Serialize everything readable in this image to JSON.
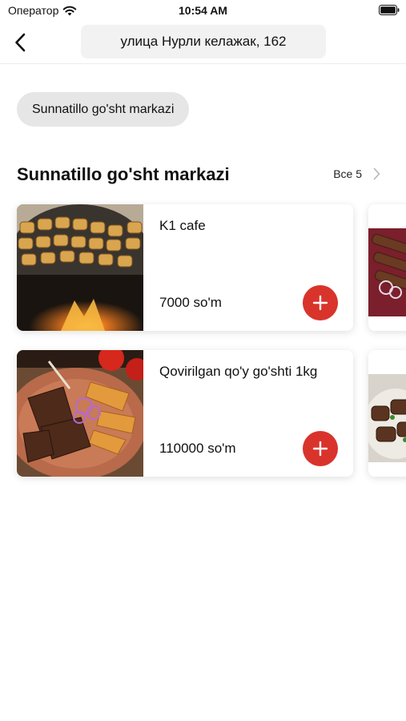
{
  "status_bar": {
    "carrier": "Оператор",
    "time": "10:54 AM",
    "wifi_icon": "wifi-icon",
    "battery_icon": "battery-icon"
  },
  "nav": {
    "back_icon": "chevron-left-icon",
    "address": "улица Нурли келажак, 162"
  },
  "shop_chip": {
    "label": "Sunnatillo go'sht markazi"
  },
  "section": {
    "title": "Sunnatillo go'sht markazi",
    "see_all_label": "Все 5",
    "see_all_icon": "chevron-right-icon"
  },
  "products": [
    {
      "name": "K1 cafe",
      "price": "7000 so'm",
      "image": "samsa-tandoor-photo",
      "add_icon": "plus-icon"
    },
    {
      "name": "Qovirilgan qo'y go'shti 1kg",
      "price": "110000 so'm",
      "image": "fried-lamb-photo",
      "add_icon": "plus-icon"
    }
  ],
  "colors": {
    "accent": "#d9342b",
    "chip_bg": "#e6e6e6",
    "address_bg": "#f2f2f2"
  }
}
